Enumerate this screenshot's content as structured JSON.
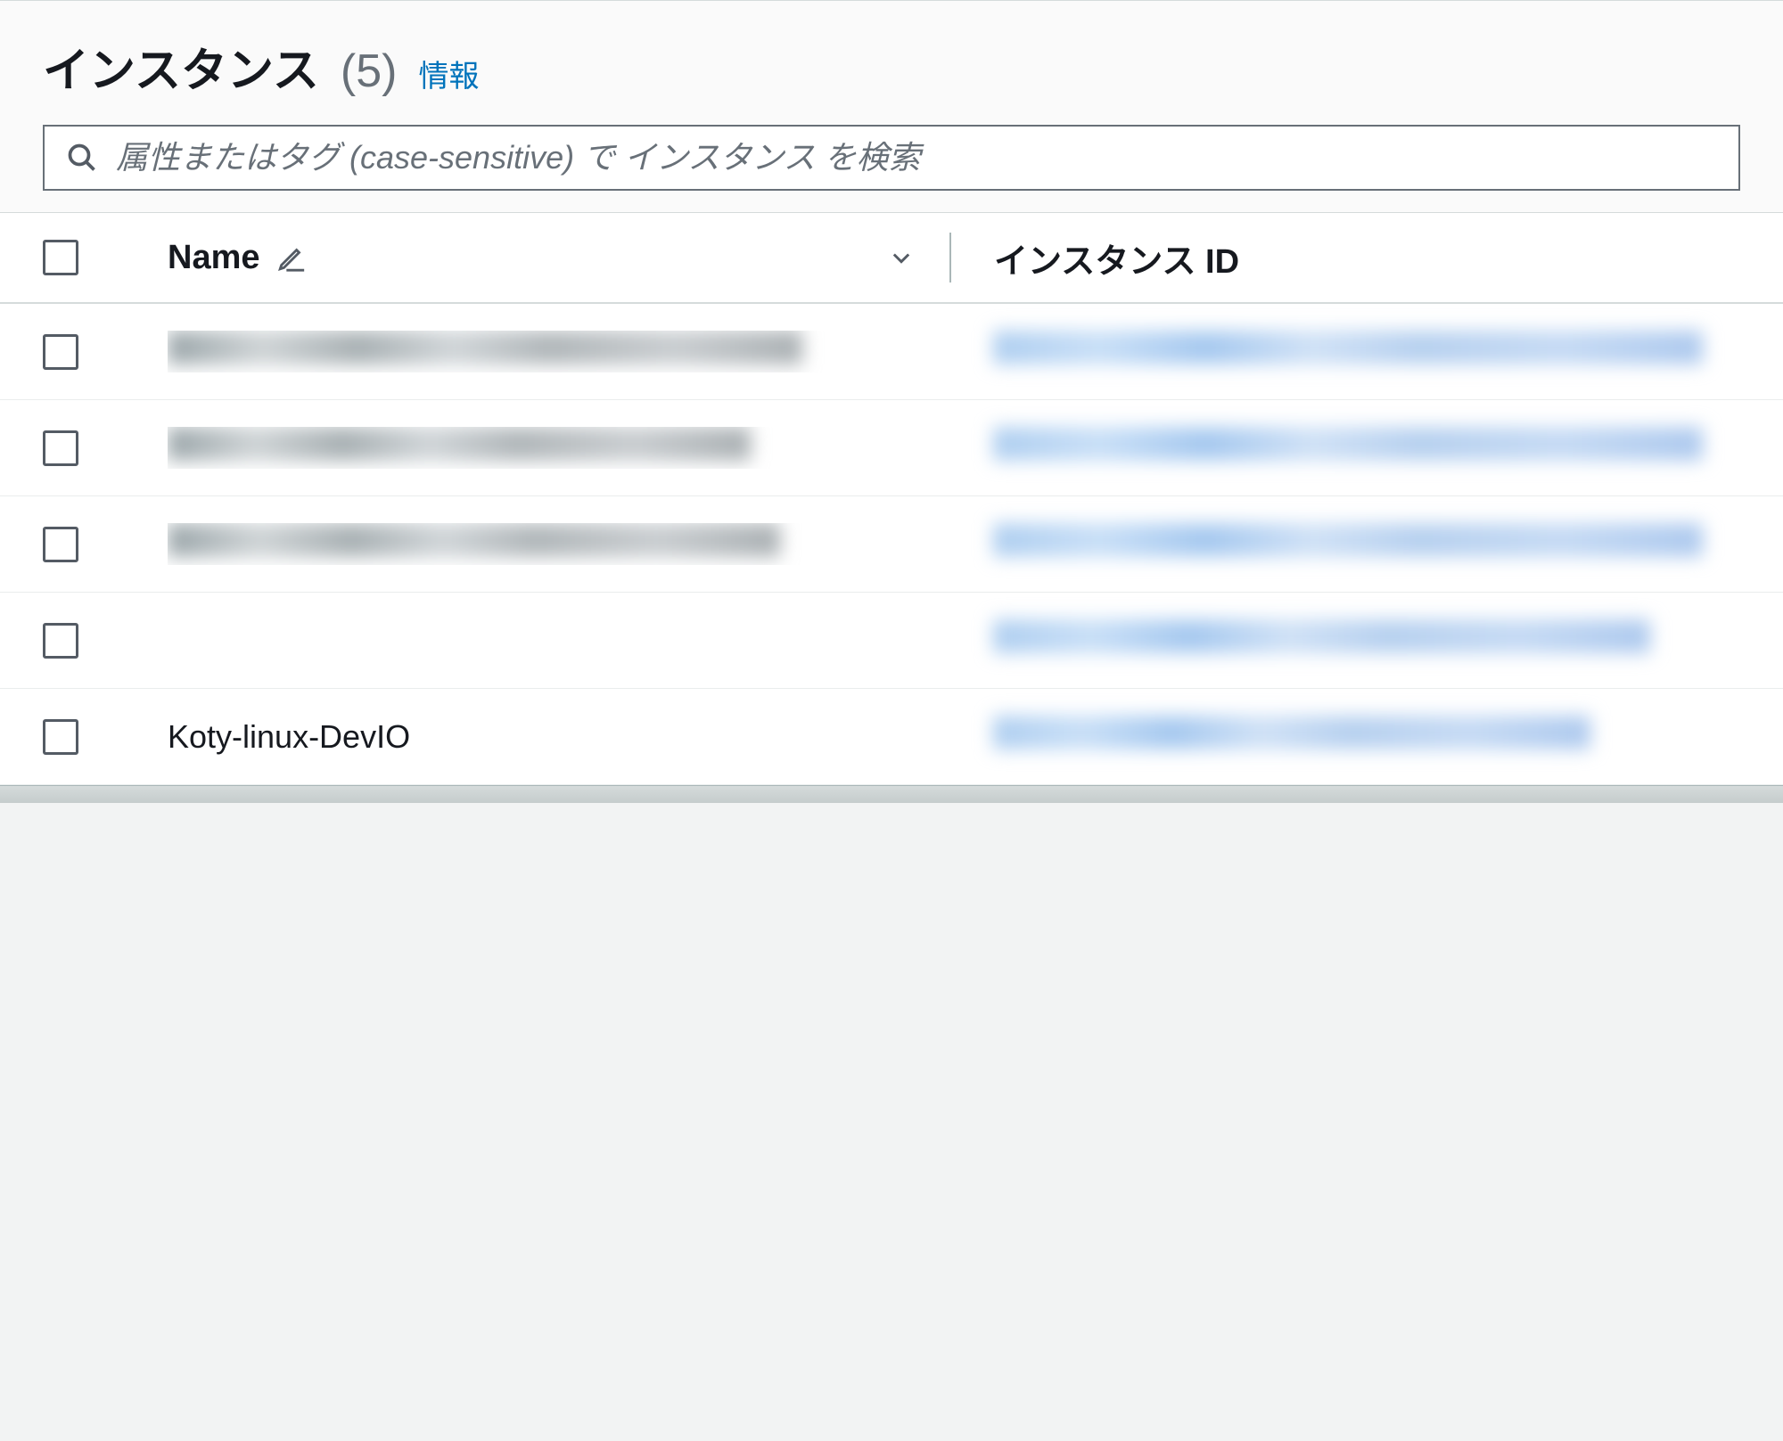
{
  "header": {
    "title": "インスタンス",
    "count": "(5)",
    "info_link": "情報"
  },
  "search": {
    "placeholder": "属性またはタグ (case-sensitive) で インスタンス を検索"
  },
  "table": {
    "columns": {
      "name": "Name",
      "instance_id": "インスタンス ID"
    },
    "rows": [
      {
        "name": "",
        "name_blurred": true,
        "id_blurred": true
      },
      {
        "name": "",
        "name_blurred": true,
        "id_blurred": true
      },
      {
        "name": "",
        "name_blurred": true,
        "id_blurred": true
      },
      {
        "name": "",
        "name_blurred": false,
        "id_blurred": true
      },
      {
        "name": "Koty-linux-DevIO",
        "name_blurred": false,
        "id_blurred": true
      }
    ]
  }
}
